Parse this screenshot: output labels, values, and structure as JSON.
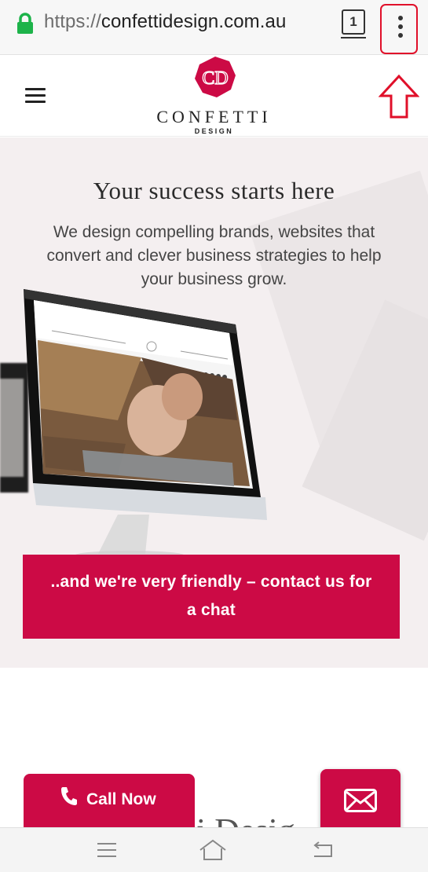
{
  "browser": {
    "url_scheme": "https://",
    "url_host": "confettidesign.com.au",
    "tab_count": "1"
  },
  "site": {
    "logo_mark": "CD",
    "logo_name": "CONFETTI",
    "logo_sub": "DESIGN"
  },
  "hero": {
    "title": "Your success starts here",
    "text": "We design compelling brands, websites that convert and clever business strategies to help your business grow.",
    "cta": "..and we're very friendly – contact us for a chat"
  },
  "actions": {
    "call_now": "Call Now"
  },
  "colors": {
    "brand": "#cc0a45",
    "annotation": "#e0102a",
    "lock": "#1db34a"
  },
  "icons": [
    "lock-icon",
    "tabs-icon",
    "more-vert-icon",
    "hamburger-icon",
    "up-arrow-icon",
    "phone-icon",
    "email-icon",
    "nav-menu-icon",
    "nav-home-icon",
    "nav-back-icon"
  ]
}
